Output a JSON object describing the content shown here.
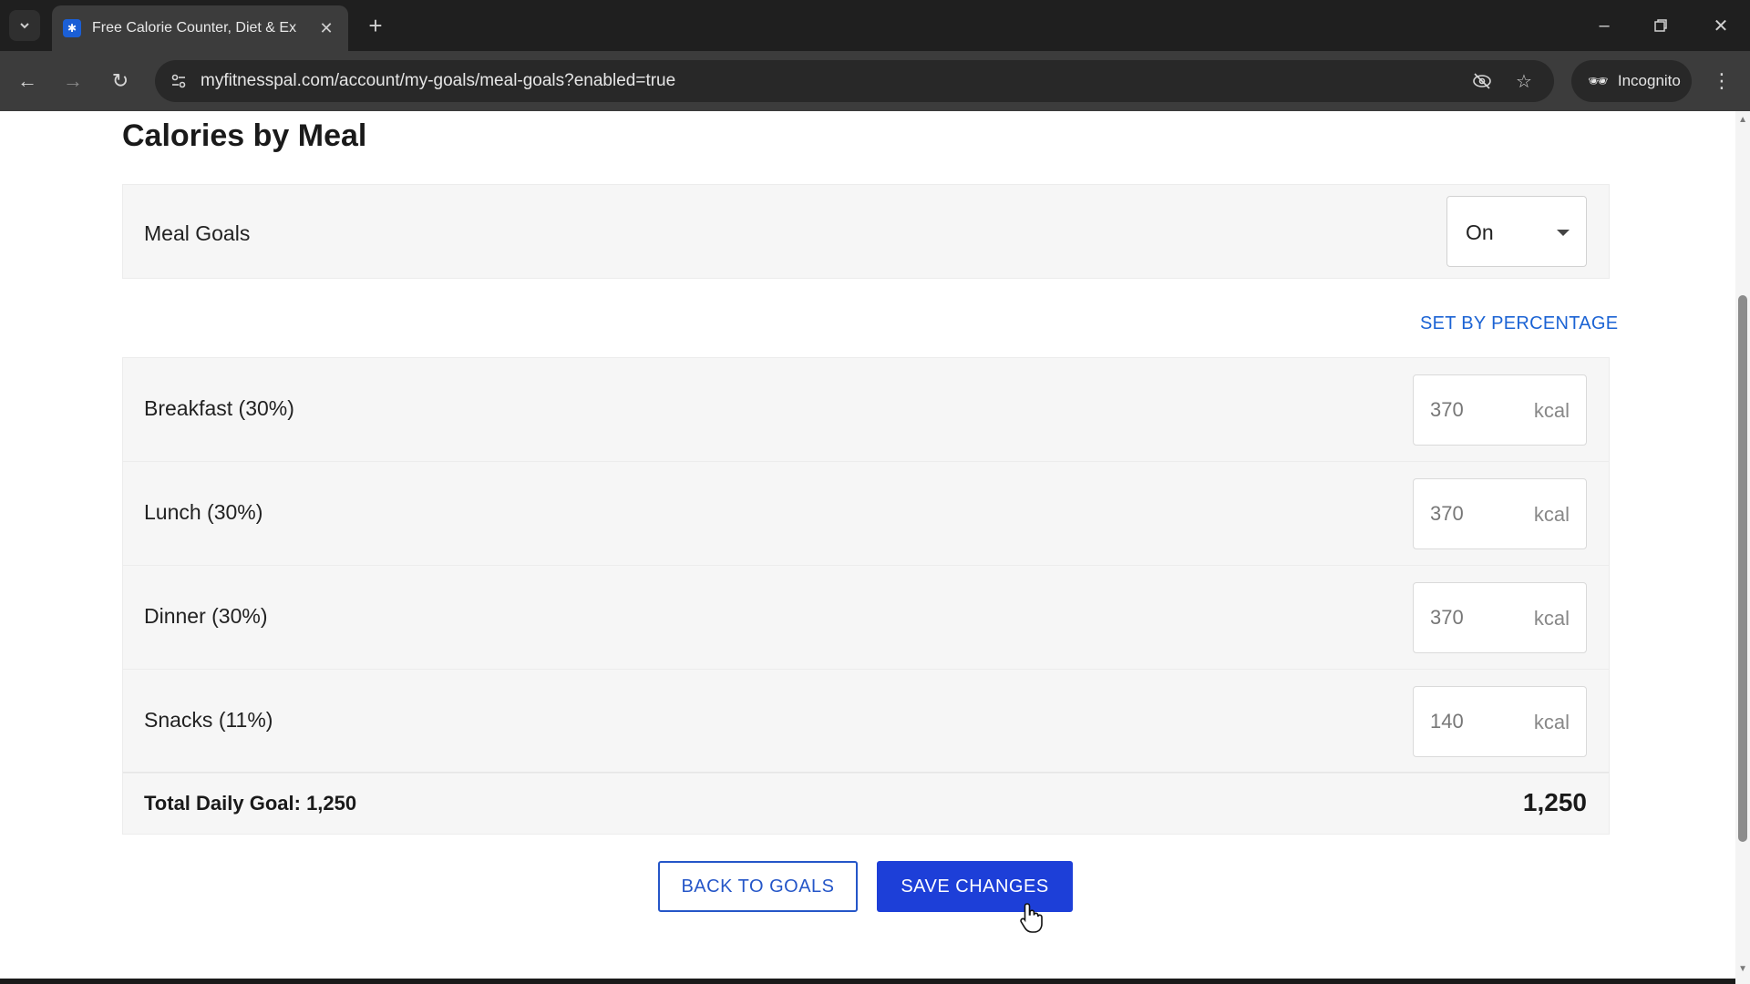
{
  "browser": {
    "tab_title": "Free Calorie Counter, Diet & Ex",
    "url": "myfitnesspal.com/account/my-goals/meal-goals?enabled=true",
    "incognito_label": "Incognito"
  },
  "page": {
    "title": "Calories by Meal",
    "meal_goals": {
      "label": "Meal Goals",
      "selected": "On"
    },
    "set_by_percentage": "SET BY PERCENTAGE",
    "meals": [
      {
        "label": "Breakfast (30%)",
        "value": "370",
        "unit": "kcal"
      },
      {
        "label": "Lunch (30%)",
        "value": "370",
        "unit": "kcal"
      },
      {
        "label": "Dinner (30%)",
        "value": "370",
        "unit": "kcal"
      },
      {
        "label": "Snacks (11%)",
        "value": "140",
        "unit": "kcal"
      }
    ],
    "total": {
      "label": "Total Daily Goal: 1,250",
      "value": "1,250"
    },
    "buttons": {
      "back": "BACK TO GOALS",
      "save": "SAVE CHANGES"
    }
  },
  "colors": {
    "accent": "#1d3fd8",
    "link": "#1b63d4"
  }
}
